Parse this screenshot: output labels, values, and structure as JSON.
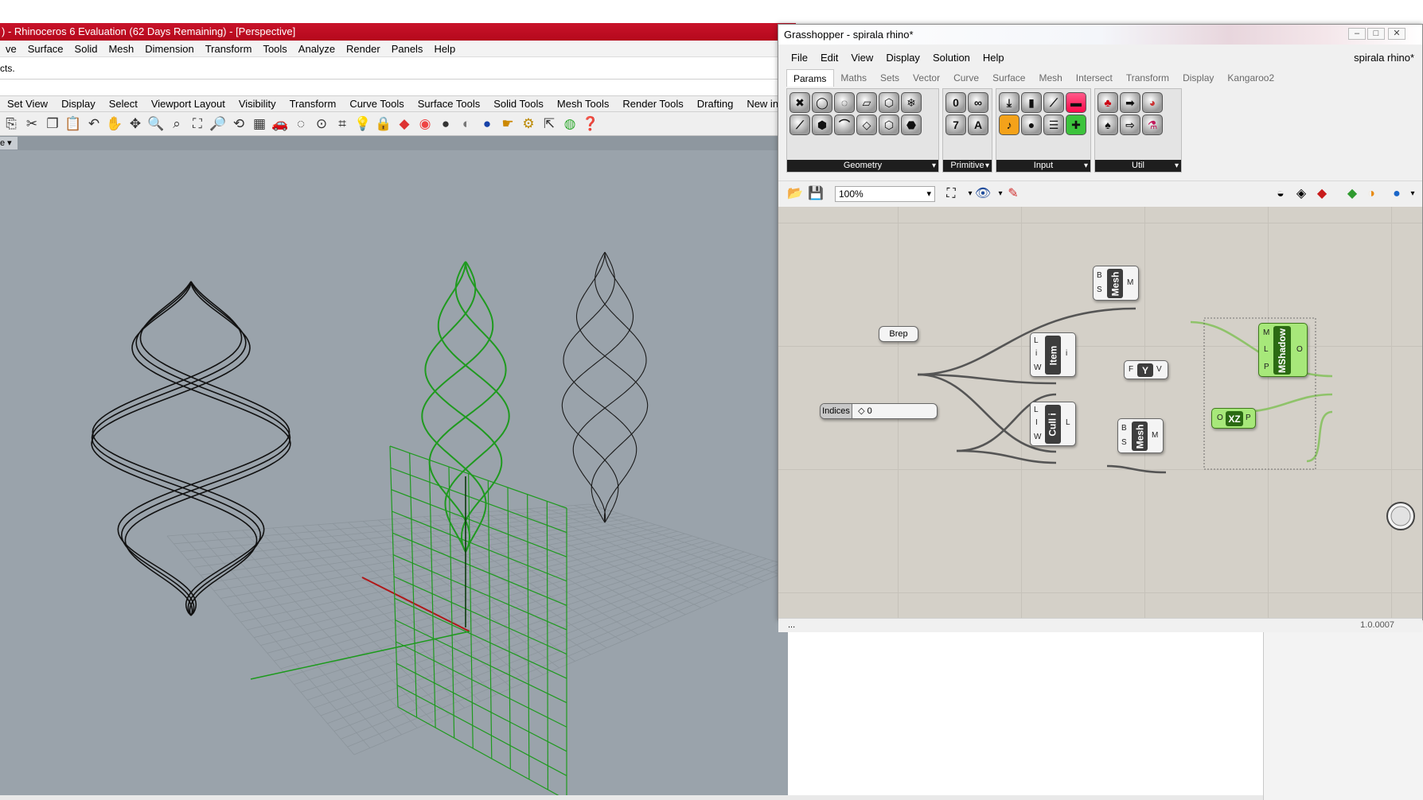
{
  "rhino": {
    "title": ") - Rhinoceros 6 Evaluation (62 Days Remaining) - [Perspective]",
    "menu": [
      "ve",
      "Surface",
      "Solid",
      "Mesh",
      "Dimension",
      "Transform",
      "Tools",
      "Analyze",
      "Render",
      "Panels",
      "Help"
    ],
    "command_history": "cts.",
    "toolbar_tabs": [
      "Set View",
      "Display",
      "Select",
      "Viewport Layout",
      "Visibility",
      "Transform",
      "Curve Tools",
      "Surface Tools",
      "Solid Tools",
      "Mesh Tools",
      "Render Tools",
      "Drafting",
      "New in V"
    ],
    "viewport_tab": "e"
  },
  "grasshopper": {
    "title": "Grasshopper - spirala rhino*",
    "document": "spirala rhino*",
    "menu": [
      "File",
      "Edit",
      "View",
      "Display",
      "Solution",
      "Help"
    ],
    "tabs": [
      "Params",
      "Maths",
      "Sets",
      "Vector",
      "Curve",
      "Surface",
      "Mesh",
      "Intersect",
      "Transform",
      "Display",
      "Kangaroo2"
    ],
    "active_tab": "Params",
    "ribbon_groups": [
      "Geometry",
      "Primitive",
      "Input",
      "Util"
    ],
    "zoom": "100%",
    "version": "1.0.0007",
    "status_left": "...",
    "nodes": {
      "brep": "Brep",
      "indices_label": "Indices",
      "indices_value": "◇ 0",
      "mesh_top": "Mesh",
      "item": "Item",
      "cull": "Cull i",
      "mesh_bottom": "Mesh",
      "mshadow": "MShadow",
      "vector_y": "Y",
      "plane_xz": "XZ"
    },
    "pins": {
      "mesh_in": [
        "B",
        "S"
      ],
      "mesh_out": "M",
      "item_in": [
        "L",
        "i",
        "W"
      ],
      "item_out": "i",
      "cull_in": [
        "L",
        "I",
        "W"
      ],
      "cull_out": "L",
      "mshadow_in": [
        "M",
        "L",
        "P"
      ],
      "mshadow_out": "O",
      "vec_in": "F",
      "vec_out": "V",
      "plane_in": "O",
      "plane_out": "P"
    }
  },
  "colors": {
    "rhino_title": "#c8132a",
    "viewport": "#9aa3ab",
    "gh_canvas": "#d4d0c8",
    "preview_green": "#1f9a1f"
  }
}
